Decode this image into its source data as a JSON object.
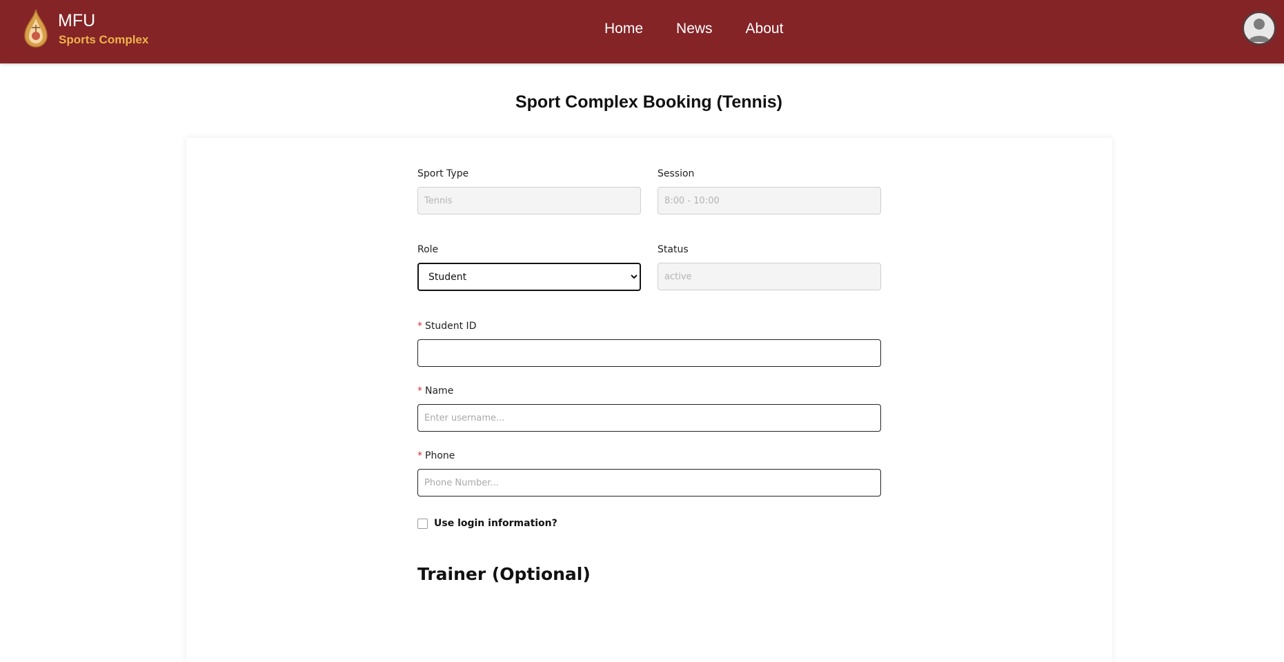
{
  "brand": {
    "title": "MFU",
    "subtitle": "Sports Complex"
  },
  "nav": {
    "items": [
      "Home",
      "News",
      "About"
    ]
  },
  "page": {
    "title": "Sport Complex Booking (Tennis)"
  },
  "form": {
    "sport_type": {
      "label": "Sport Type",
      "value": "Tennis"
    },
    "session": {
      "label": "Session",
      "value": "8:00 - 10:00"
    },
    "role": {
      "label": "Role",
      "selected": "Student"
    },
    "status": {
      "label": "Status",
      "value": "active"
    },
    "student_id": {
      "label": "Student ID",
      "value": ""
    },
    "name": {
      "label": "Name",
      "placeholder": "Enter username..."
    },
    "phone": {
      "label": "Phone",
      "placeholder": "Phone Number..."
    },
    "required_mark": "*",
    "use_login": {
      "label": "Use login information?",
      "checked": false
    }
  },
  "trainer": {
    "title": "Trainer (Optional)"
  },
  "colors": {
    "navbar": "#842427",
    "brand_accent": "#f0b24a",
    "required": "#d6303b"
  },
  "icons": {
    "logo": "mfu-emblem-icon",
    "avatar": "user-avatar-icon",
    "select_arrow": "chevron-down-icon"
  }
}
